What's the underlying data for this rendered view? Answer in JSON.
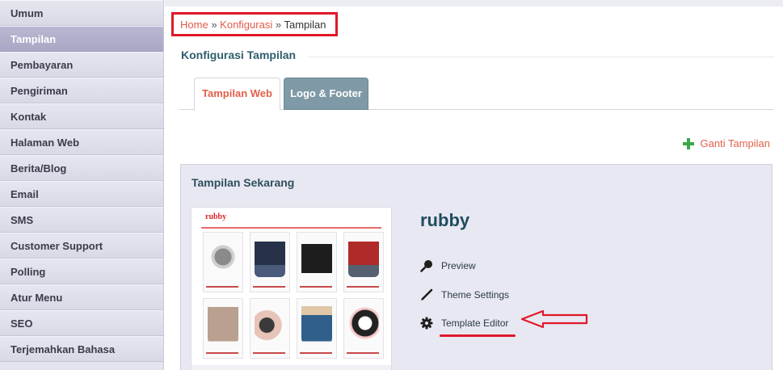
{
  "sidebar": {
    "items": [
      {
        "label": "Umum"
      },
      {
        "label": "Tampilan"
      },
      {
        "label": "Pembayaran"
      },
      {
        "label": "Pengiriman"
      },
      {
        "label": "Kontak"
      },
      {
        "label": "Halaman Web"
      },
      {
        "label": "Berita/Blog"
      },
      {
        "label": "Email"
      },
      {
        "label": "SMS"
      },
      {
        "label": "Customer Support"
      },
      {
        "label": "Polling"
      },
      {
        "label": "Atur Menu"
      },
      {
        "label": "SEO"
      },
      {
        "label": "Terjemahkan Bahasa"
      }
    ],
    "active": "Tampilan"
  },
  "breadcrumb": {
    "home": "Home",
    "sep": "»",
    "konfigurasi": "Konfigurasi",
    "current": "Tampilan"
  },
  "page": {
    "title": "Konfigurasi Tampilan",
    "tabs": [
      {
        "label": "Tampilan Web",
        "active": true
      },
      {
        "label": "Logo & Footer",
        "active": false
      }
    ],
    "ganti_label": "Ganti Tampilan"
  },
  "current_theme": {
    "heading": "Tampilan Sekarang",
    "thumbnail_logo": "rubby",
    "name": "rubby",
    "actions": [
      {
        "label": "Preview",
        "icon": "magnifier-icon"
      },
      {
        "label": "Theme Settings",
        "icon": "pencil-icon"
      },
      {
        "label": "Template Editor",
        "icon": "gear-icon"
      }
    ]
  },
  "colors": {
    "accent_red": "#e2604c",
    "annotation_red": "#e0182a",
    "tab_inactive": "#7f9aa6",
    "title_teal": "#2f5e6d"
  }
}
